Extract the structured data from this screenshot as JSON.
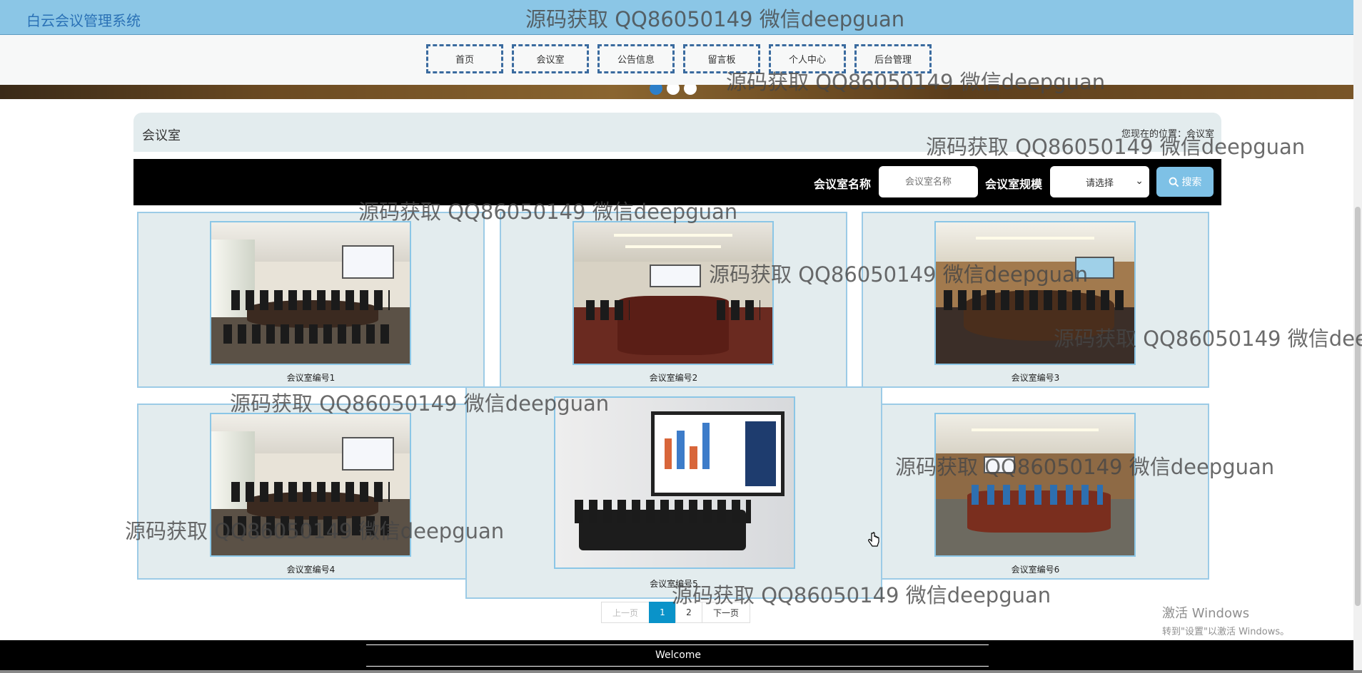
{
  "header": {
    "site_title": "白云会议管理系统"
  },
  "nav": {
    "items": [
      "首页",
      "会议室",
      "公告信息",
      "留言板",
      "个人中心",
      "后台管理"
    ]
  },
  "page": {
    "title": "会议室",
    "location": "您现在的位置：会议室"
  },
  "search": {
    "name_label": "会议室名称",
    "name_placeholder": "会议室名称",
    "scale_label": "会议室规模",
    "scale_selected": "请选择",
    "button_label": "搜索"
  },
  "rooms": [
    {
      "caption": "会议室编号1"
    },
    {
      "caption": "会议室编号2"
    },
    {
      "caption": "会议室编号3"
    },
    {
      "caption": "会议室编号4"
    },
    {
      "caption": "会议室编号5"
    },
    {
      "caption": "会议室编号6"
    }
  ],
  "pager": {
    "prev": "上一页",
    "pages": [
      "1",
      "2"
    ],
    "current": "1",
    "next": "下一页"
  },
  "footer": {
    "text": "Welcome"
  },
  "os_notice": {
    "title": "激活 Windows",
    "subtitle": "转到\"设置\"以激活 Windows。"
  },
  "watermark": {
    "text": "源码获取 QQ86050149 微信deepguan"
  },
  "colors": {
    "header_bg": "#8bc6e6",
    "nav_border": "#3a6b9f",
    "card_bg": "#e3ecee",
    "pager_active": "#0a93c9",
    "search_button": "#7ec1e6"
  }
}
